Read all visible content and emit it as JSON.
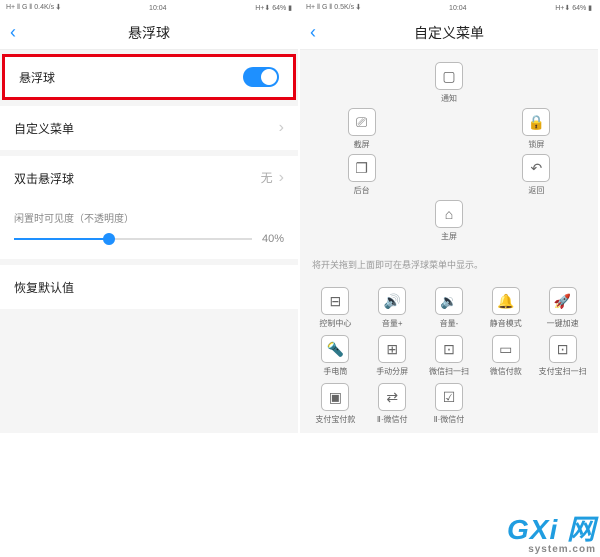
{
  "statusbar": {
    "left1": "H+ ⫴ G ⫴ 0.4K/s ⬇",
    "time": "10:04",
    "right": "H+⬇ 64% ▮",
    "left2": "H+ ⫴ G ⫴ 0.5K/s ⬇"
  },
  "left": {
    "title": "悬浮球",
    "rows": {
      "main": "悬浮球",
      "custom": "自定义菜单",
      "double": "双击悬浮球",
      "double_val": "无",
      "reset": "恢复默认值"
    },
    "slider": {
      "label": "闲置时可见度（不透明度）",
      "value": "40%"
    }
  },
  "right": {
    "title": "自定义菜单",
    "hint": "将开关拖到上面即可在悬浮球菜单中显示。",
    "top": [
      {
        "icon": "▢",
        "label": "通知"
      },
      {
        "icon": "⎚",
        "label": "截屏"
      },
      {
        "icon": "🔒",
        "label": "锁屏"
      },
      {
        "icon": "❐",
        "label": "后台"
      },
      {
        "icon": "↶",
        "label": "返回"
      },
      {
        "icon": "⌂",
        "label": "主屏"
      }
    ],
    "bottom": [
      {
        "icon": "⊟",
        "label": "控制中心"
      },
      {
        "icon": "🔊",
        "label": "音量+"
      },
      {
        "icon": "🔉",
        "label": "音量-"
      },
      {
        "icon": "🔔",
        "label": "静音模式"
      },
      {
        "icon": "🚀",
        "label": "一键加速"
      },
      {
        "icon": "🔦",
        "label": "手电筒"
      },
      {
        "icon": "⊞",
        "label": "手动分屏"
      },
      {
        "icon": "⊡",
        "label": "微信扫一扫"
      },
      {
        "icon": "▭",
        "label": "微信付款"
      },
      {
        "icon": "⊡",
        "label": "支付宝扫一扫"
      },
      {
        "icon": "▣",
        "label": "支付宝付款"
      },
      {
        "icon": "⇄",
        "label": "Ⅱ·微信付"
      },
      {
        "icon": "☑",
        "label": "Ⅱ·微信付"
      }
    ]
  },
  "watermark": {
    "brand": "GXi 网",
    "url": "system.com"
  }
}
